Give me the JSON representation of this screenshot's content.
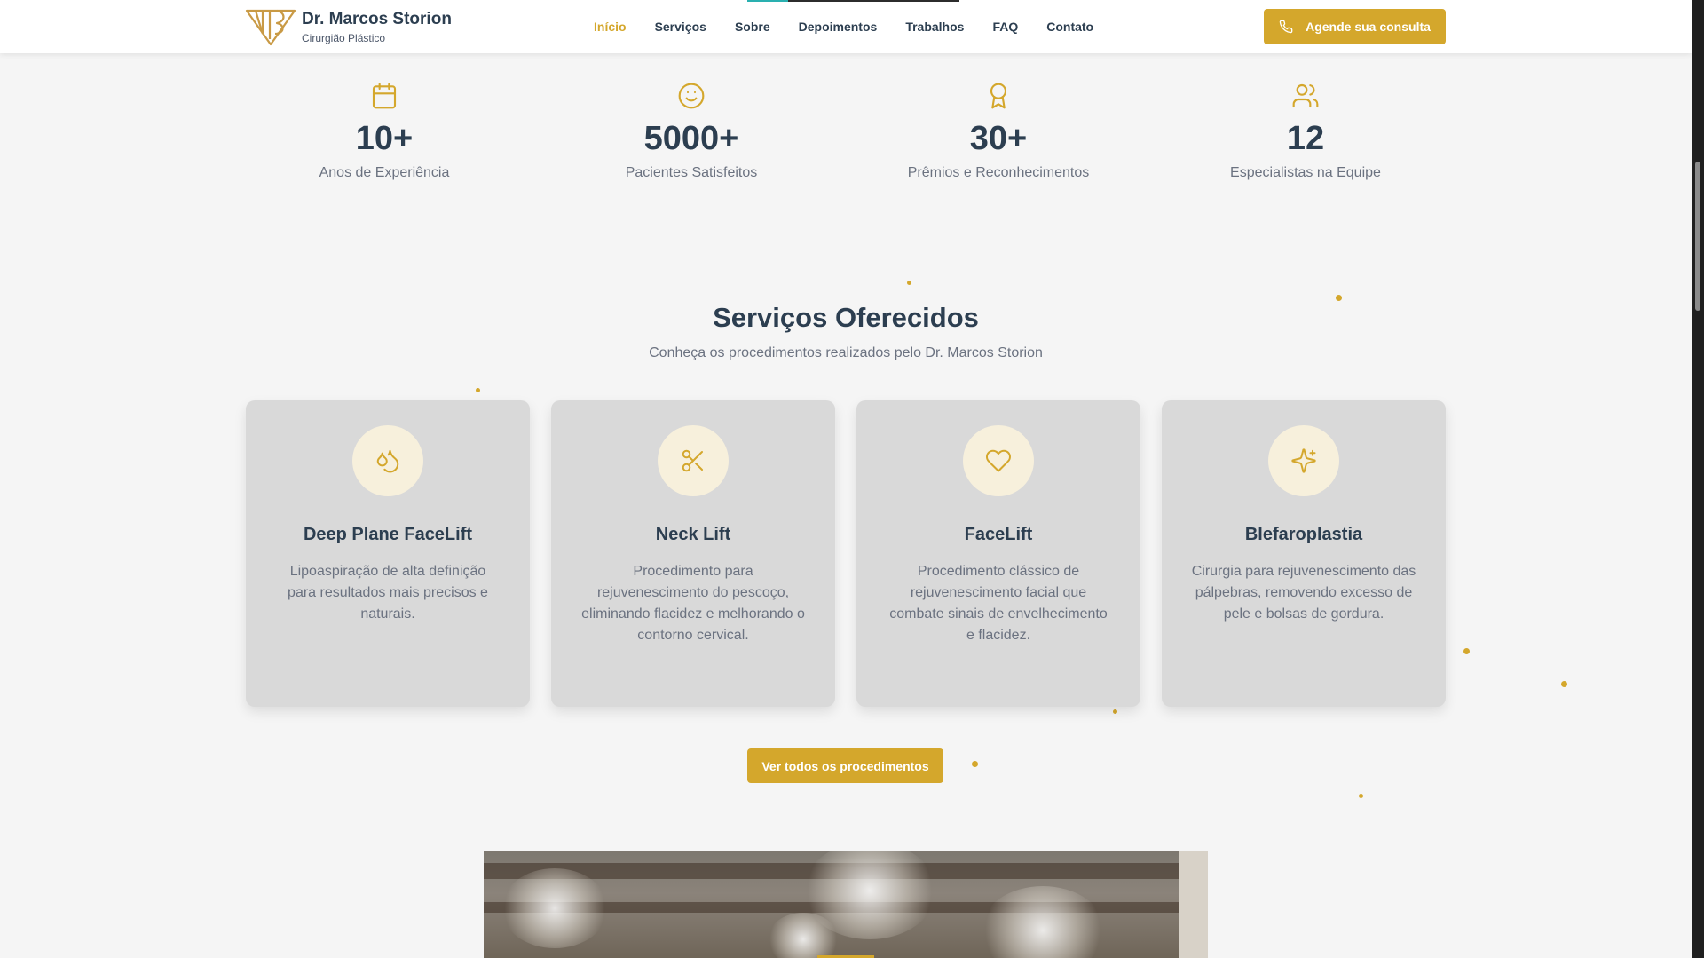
{
  "header": {
    "brand_name": "Dr. Marcos Storion",
    "brand_subtitle": "Cirurgião Plástico",
    "nav": [
      {
        "label": "Início",
        "active": true
      },
      {
        "label": "Serviços",
        "active": false
      },
      {
        "label": "Sobre",
        "active": false
      },
      {
        "label": "Depoimentos",
        "active": false
      },
      {
        "label": "Trabalhos",
        "active": false
      },
      {
        "label": "FAQ",
        "active": false
      },
      {
        "label": "Contato",
        "active": false
      }
    ],
    "cta_label": "Agende sua consulta",
    "cta_icon": "phone-icon"
  },
  "stats": [
    {
      "icon": "calendar-icon",
      "value": "10+",
      "label": "Anos de Experiência"
    },
    {
      "icon": "smile-icon",
      "value": "5000+",
      "label": "Pacientes Satisfeitos"
    },
    {
      "icon": "award-icon",
      "value": "30+",
      "label": "Prêmios e Reconhecimentos"
    },
    {
      "icon": "users-icon",
      "value": "12",
      "label": "Especialistas na Equipe"
    }
  ],
  "services": {
    "title": "Serviços Oferecidos",
    "subtitle": "Conheça os procedimentos realizados pelo Dr. Marcos Storion",
    "cards": [
      {
        "icon": "droplets-icon",
        "title": "Deep Plane FaceLift",
        "description": "Lipoaspiração de alta definição para resultados mais precisos e naturais."
      },
      {
        "icon": "scissors-icon",
        "title": "Neck Lift",
        "description": "Procedimento para rejuvenescimento do pescoço, eliminando flacidez e melhorando o contorno cervical."
      },
      {
        "icon": "heart-icon",
        "title": "FaceLift",
        "description": "Procedimento clássico de rejuvenescimento facial que combate sinais de envelhecimento e flacidez."
      },
      {
        "icon": "sparkles-icon",
        "title": "Blefaroplastia",
        "description": "Cirurgia para rejuvenescimento das pálpebras, removendo excesso de pele e bolsas de gordura."
      }
    ],
    "button_label": "Ver todos os procedimentos"
  },
  "colors": {
    "accent": "#d4a72c",
    "heading": "#2c3e50",
    "muted": "#6b7280",
    "card_bg": "#d9d9d9",
    "icon_circle": "#f7f0dc"
  }
}
